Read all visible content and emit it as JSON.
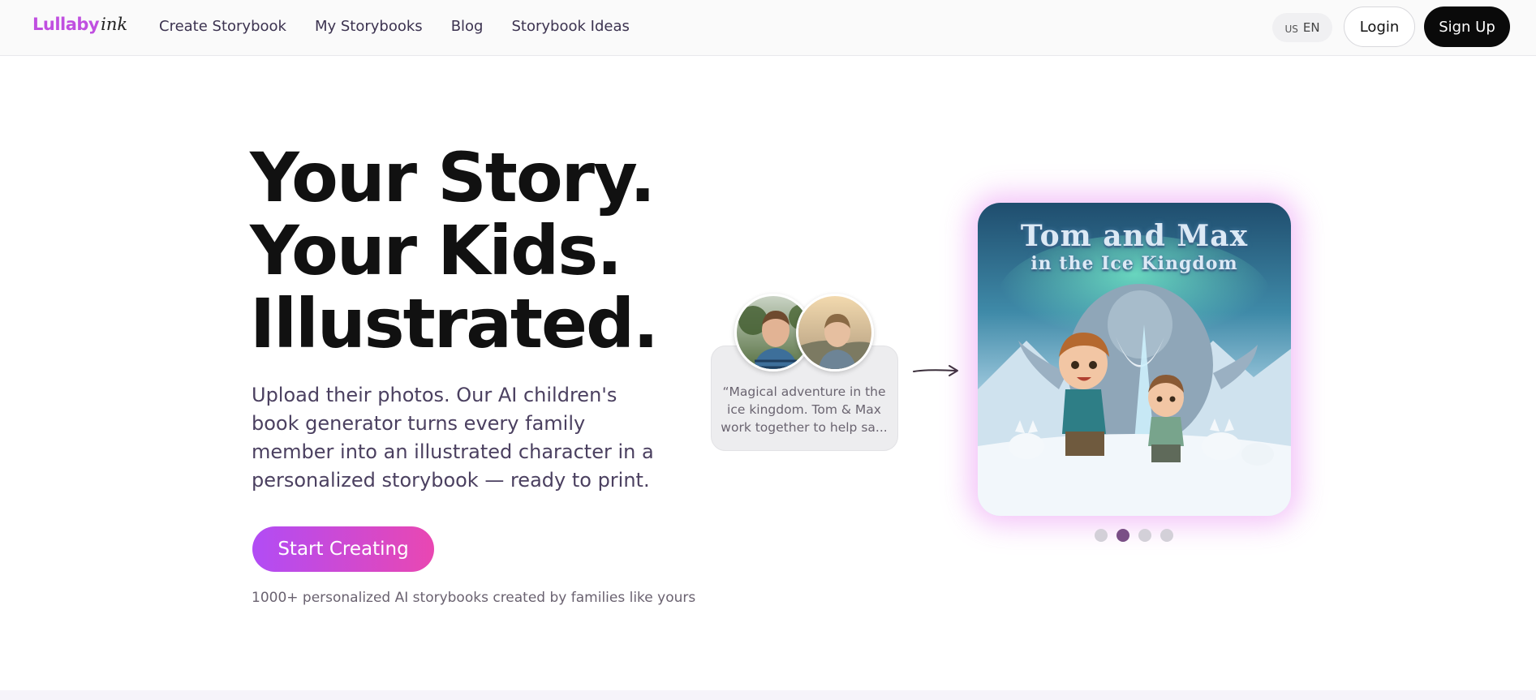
{
  "nav": {
    "logo_part1": "Lullaby",
    "logo_part2": "ink",
    "links": [
      "Create Storybook",
      "My Storybooks",
      "Blog",
      "Storybook Ideas"
    ],
    "lang_flag": "US",
    "lang_code": "EN",
    "login_label": "Login",
    "signup_label": "Sign Up"
  },
  "hero": {
    "title_lines": [
      "Your Story.",
      "Your Kids.",
      "Illustrated."
    ],
    "subtitle": "Upload their photos. Our AI children's book generator turns every family member into an illustrated character in a personalized storybook — ready to print.",
    "cta_label": "Start Creating",
    "social_proof": "1000+ personalized AI storybooks created by families like yours"
  },
  "example": {
    "quote": "“Magical adventure in the ice kingdom. Tom & Max work together to help sa...",
    "arrow_icon": "arrow-right-icon",
    "cover_title_line1": "Tom and Max",
    "cover_title_line2": "in the Ice Kingdom",
    "carousel_count": 4,
    "carousel_active_index": 1
  },
  "colors": {
    "accent_start": "#b14cf5",
    "accent_end": "#e947b2",
    "logo": "#c04fe0",
    "dark_button": "#0a0a0a"
  }
}
